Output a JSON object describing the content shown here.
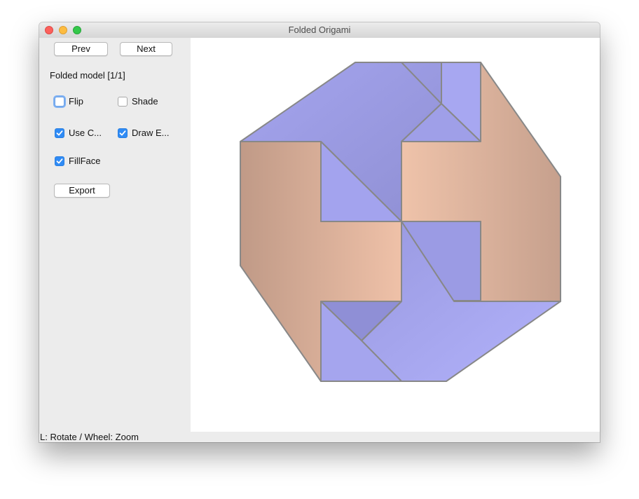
{
  "window": {
    "title": "Folded Origami"
  },
  "sidebar": {
    "prev_label": "Prev",
    "next_label": "Next",
    "model_label": "Folded model [1/1]",
    "checkboxes": [
      {
        "label": "Flip",
        "checked": false
      },
      {
        "label": "Shade",
        "checked": false
      },
      {
        "label": "Use C...",
        "checked": true
      },
      {
        "label": "Draw E...",
        "checked": true
      },
      {
        "label": "FillFace",
        "checked": true
      }
    ],
    "export_label": "Export"
  },
  "status": {
    "hint": "L: Rotate / Wheel: Zoom"
  },
  "colors": {
    "front_face": "#a9a9f2",
    "back_face": "#e2b59c",
    "edge": "#888888"
  }
}
